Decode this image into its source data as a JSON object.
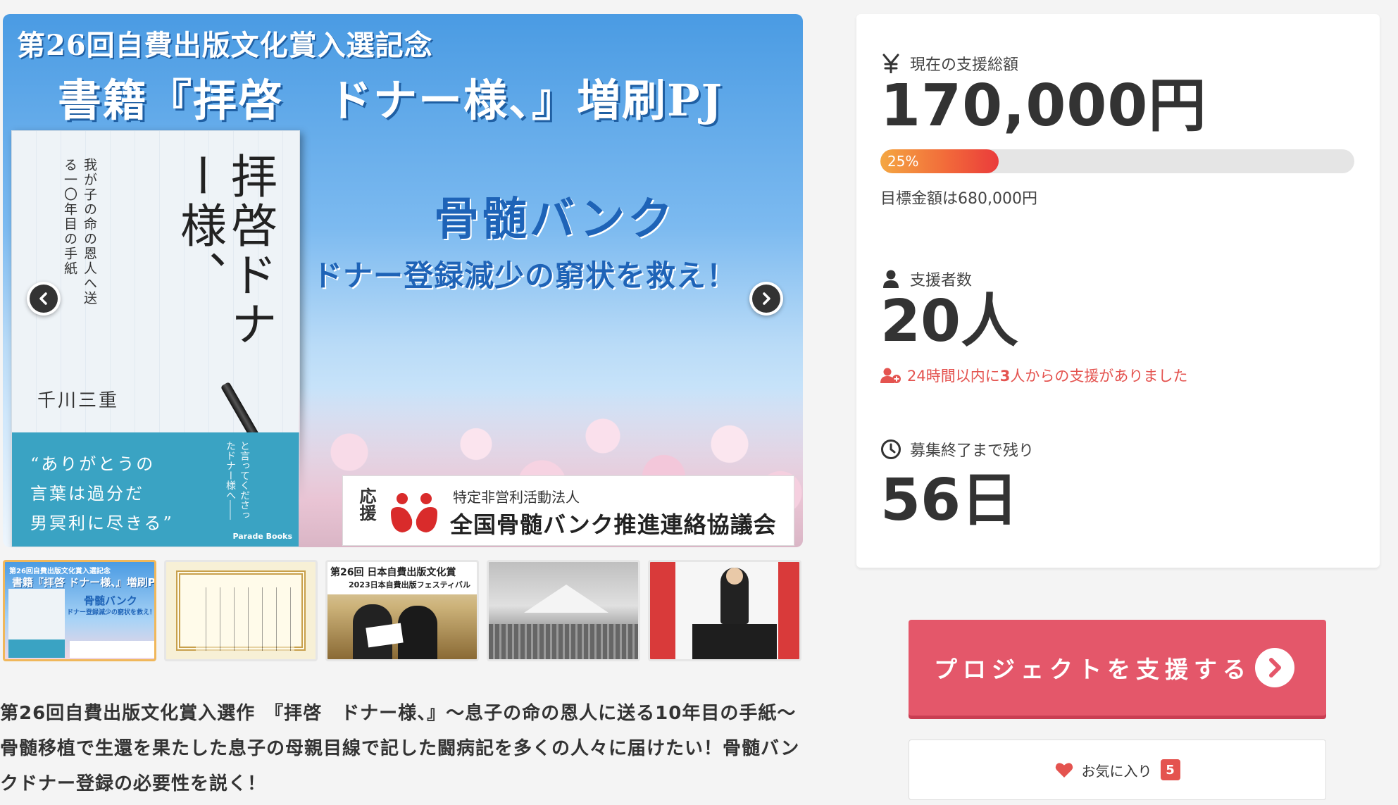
{
  "hero": {
    "title_line1": "第26回自費出版文化賞入選記念",
    "title_line2": "書籍『拝啓　ドナー様、』増刷PJ",
    "book": {
      "subtitle": "我が子の命の恩人へ送る一〇年目の手紙",
      "title": "拝啓ドナー様、",
      "author": "千川三重",
      "quote": "“ありがとうの\n言葉は過分だ\n男冥利に尽きる”",
      "thanks_note": "と言ってくださったドナー様へ――",
      "publisher": "Parade Books"
    },
    "headline": "骨髄バンク",
    "subheadline": "ドナー登録減少の窮状を救え！",
    "sponsor": {
      "label": "応援",
      "org_type": "特定非営利活動法人",
      "org_name": "全国骨髄バンク推進連絡協議会"
    },
    "prev_icon": "chevron-left-icon",
    "next_icon": "chevron-right-icon"
  },
  "thumbnails": [
    {
      "name": "thumb-cover",
      "active": true,
      "title1": "第26回自費出版文化賞入選記念",
      "title2": "書籍『拝啓 ドナー様、』増刷PJ",
      "headline": "骨髄バンク",
      "subheadline": "ドナー登録減少の窮状を救え！"
    },
    {
      "name": "thumb-certificate",
      "active": false
    },
    {
      "name": "thumb-award-ceremony",
      "active": false,
      "banner1": "第26回 日本自費出版文化賞",
      "banner2": "2023日本自費出版フェスティバル"
    },
    {
      "name": "thumb-mt-fuji",
      "active": false
    },
    {
      "name": "thumb-speech",
      "active": false
    }
  ],
  "description": "第26回自費出版文化賞入選作　『拝啓　ドナー様、』〜息子の命の恩人に送る10年目の手紙〜骨髄移植で生還を果たした息子の母親目線で記した闘病記を多くの人々に届けたい！骨髄バンクドナー登録の必要性を説く！",
  "stats": {
    "amount_label": "現在の支援総額",
    "amount_icon": "yen-icon",
    "amount": "170,000円",
    "progress_percent": 25,
    "progress_label": "25%",
    "goal_text": "目標金額は680,000円",
    "supporters_label": "支援者数",
    "supporters_icon": "user-icon",
    "supporters": "20人",
    "recent_prefix": "24時間以内に",
    "recent_count": "3",
    "recent_suffix": "人からの支援がありました",
    "recent_icon": "user-plus-icon",
    "remaining_label": "募集終了まで残り",
    "remaining_icon": "clock-icon",
    "remaining": "56日"
  },
  "actions": {
    "support_label": "プロジェクトを支援する",
    "support_icon": "chevron-right-circle-icon",
    "favorite_label": "お気に入り",
    "favorite_icon": "heart-icon",
    "favorite_count": "5"
  },
  "colors": {
    "accent": "#e4576a",
    "alert": "#e4534f",
    "progress_start": "#f4a742",
    "progress_end": "#ea3b3b"
  }
}
